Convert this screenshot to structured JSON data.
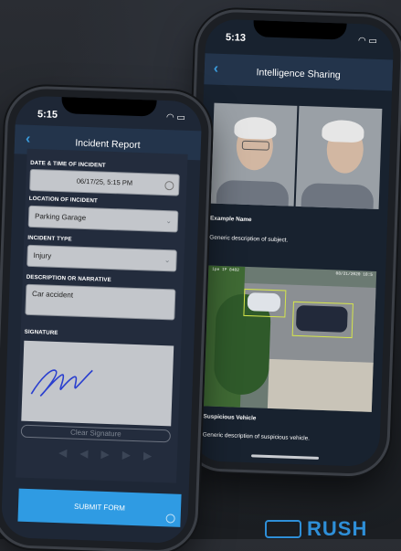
{
  "left_phone": {
    "status_time": "5:15",
    "nav_title": "Incident Report",
    "fields": {
      "datetime_label": "DATE & TIME OF INCIDENT",
      "datetime_value": "06/17/25, 5:15 PM",
      "location_label": "LOCATION OF INCIDENT",
      "location_value": "Parking Garage",
      "type_label": "INCIDENT TYPE",
      "type_value": "Injury",
      "description_label": "DESCRIPTION OR NARRATIVE",
      "description_value": "Car accident",
      "signature_label": "SIGNATURE"
    },
    "clear_signature_label": "Clear Signature",
    "submit_label": "SUBMIT FORM"
  },
  "right_phone": {
    "status_time": "5:13",
    "nav_title": "Intelligence Sharing",
    "items": [
      {
        "title": "Example Name",
        "description": "Generic description of subject."
      },
      {
        "title": "Suspicious Vehicle",
        "description": "Generic description of suspicious vehicle."
      }
    ],
    "camera_osd_left": "ipe IP 8482",
    "camera_osd_right": "08/21/2020 18:5"
  },
  "brand": {
    "text": "RUSH"
  },
  "colors": {
    "accent": "#2f9be3",
    "nav_bg": "#23344b"
  }
}
